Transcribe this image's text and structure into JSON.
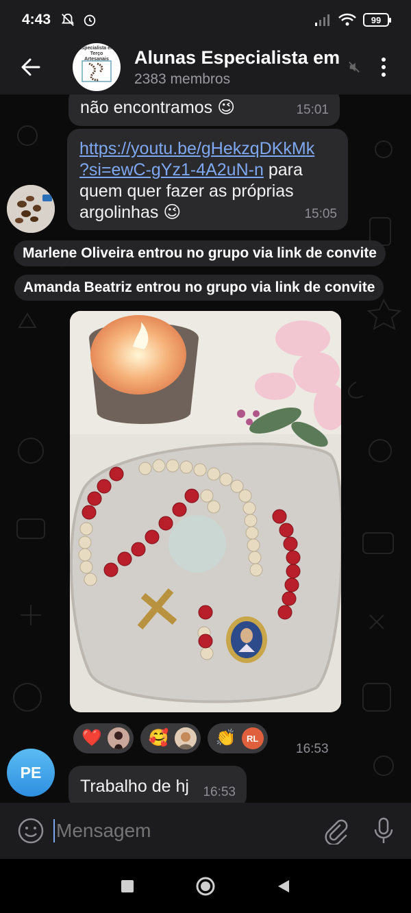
{
  "status_bar": {
    "time": "4:43",
    "battery": "99"
  },
  "header": {
    "title": "Alunas Especialista em",
    "subtitle": "2383 membros",
    "avatar_text_line1": "Especialista em Terço",
    "avatar_text_line2": "Artesanais"
  },
  "messages": [
    {
      "text": "não encontramos 😉",
      "time": "15:01"
    },
    {
      "link": "https://youtu.be/gHekzqDKkMk?si=ewC-gYz1-4A2uN-n",
      "link_line1": "https://youtu.be/gHekzqDKkMk",
      "link_line2": "?si=ewC-gYz1-4A2uN-n",
      "text_after": "para",
      "text_line3": "quem quer fazer as próprias",
      "text_line4": "argolinhas 😉",
      "time": "15:05"
    }
  ],
  "service_messages": [
    "Marlene Oliveira entrou no grupo via link de convite",
    "Amanda Beatriz entrou no grupo via link de convite"
  ],
  "photo_message": {
    "reactions": [
      {
        "emoji": "❤️"
      },
      {
        "emoji": "🥰"
      },
      {
        "emoji": "👏",
        "initials": "RL"
      }
    ],
    "time": "16:53"
  },
  "last_message": {
    "sender_initials": "PE",
    "text": "Trabalho de hj",
    "time": "16:53"
  },
  "input": {
    "placeholder": "Mensagem"
  },
  "colors": {
    "background": "#0b0b0c",
    "bubble": "#2a2a2c",
    "link": "#7ea8f2",
    "avatar_pe": "#3aa3e8",
    "rl": "#e0603e"
  }
}
